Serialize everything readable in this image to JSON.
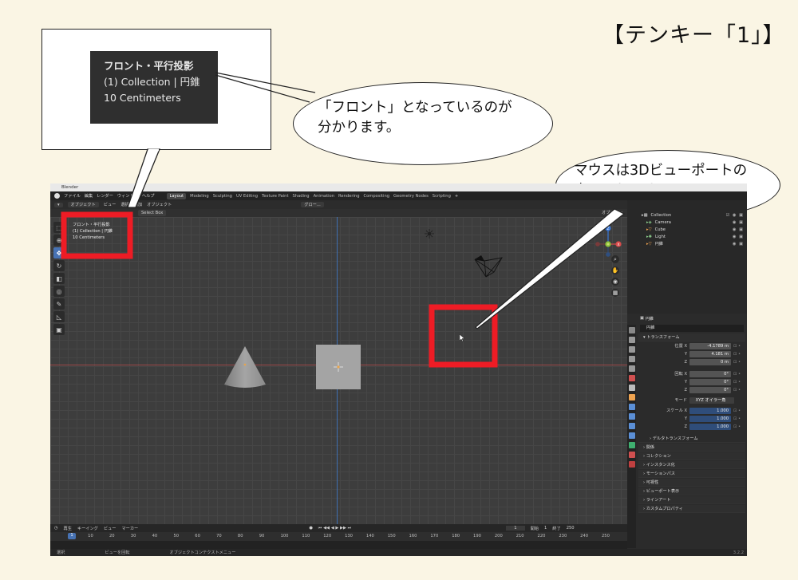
{
  "page_heading": "【テンキー「1」】",
  "zoom_callout": {
    "lines": [
      "フロント・平行投影",
      "(1) Collection | 円錐",
      "10 Centimeters"
    ]
  },
  "bubble1": {
    "lines": [
      "「フロント」となっているのが",
      "分かります。"
    ]
  },
  "bubble2": {
    "lines": [
      "マウスは3Dビューポートの",
      "中にあります。"
    ]
  },
  "colors": {
    "highlight": "#ee1c25",
    "active_blue": "#4772b3",
    "x_axis": "#9c4848",
    "y_axis": "#3f6fb0"
  },
  "blender": {
    "title": "Blender",
    "menus": [
      "ファイル",
      "編集",
      "レンダー",
      "ウィンドウ",
      "ヘルプ"
    ],
    "workspaces": [
      "Layout",
      "Modeling",
      "Sculpting",
      "UV Editing",
      "Texture Paint",
      "Shading",
      "Animation",
      "Rendering",
      "Compositing",
      "Geometry Nodes",
      "Scripting"
    ],
    "workspace_add": "+",
    "viewport_header": {
      "mode": "オブジェクト",
      "menus": [
        "ビュー",
        "選択",
        "追加",
        "オブジェクト"
      ],
      "transform_orientation": "グロー..."
    },
    "tool_options": {
      "select_box": "Select Box",
      "options": "オプション"
    },
    "overlay_text": [
      "フロント・平行投影",
      "(1) Collection | 円錐",
      "10 Centimeters"
    ],
    "gizmo": {
      "z": "Z",
      "x": "X"
    },
    "timeline": {
      "menus": [
        "再生",
        "キーイング",
        "ビュー",
        "マーカー"
      ],
      "current_frame": "1",
      "start_label": "開始",
      "start": "1",
      "end_label": "終了",
      "end": "250",
      "ticks": [
        "1",
        "10",
        "20",
        "30",
        "40",
        "50",
        "60",
        "70",
        "80",
        "90",
        "100",
        "110",
        "120",
        "130",
        "140",
        "150",
        "160",
        "170",
        "180",
        "190",
        "200",
        "210",
        "220",
        "230",
        "240",
        "250"
      ]
    },
    "statusbar": [
      "選択",
      "ビューを回転",
      "オブジェクトコンテクストメニュー"
    ],
    "version": "3.2.2",
    "outliner": {
      "rows": [
        {
          "name": "Collection"
        },
        {
          "name": "Camera"
        },
        {
          "name": "Cube"
        },
        {
          "name": "Light"
        },
        {
          "name": "円錐"
        }
      ]
    },
    "properties": {
      "object_name": "円錐",
      "object_field": "円錐",
      "transform_title": "トランスフォーム",
      "location_label": "位置 X",
      "loc_x": "-4.1789 m",
      "loc_y": "4.181 m",
      "loc_z": "0 m",
      "rotation_label": "回転 X",
      "rot_x": "0°",
      "rot_y": "0°",
      "rot_z": "0°",
      "mode_label": "モード",
      "mode_value": "XYZ オイラー角",
      "scale_label": "スケール X",
      "scale_x": "1.000",
      "scale_y": "1.000",
      "scale_z": "1.000",
      "y_label": "Y",
      "z_label": "Z",
      "delta": "デルタトランスフォーム",
      "sections": [
        "関係",
        "コレクション",
        "インスタンス化",
        "モーションパス",
        "可視性",
        "ビューポート表示",
        "ラインアート",
        "カスタムプロパティ"
      ]
    }
  }
}
